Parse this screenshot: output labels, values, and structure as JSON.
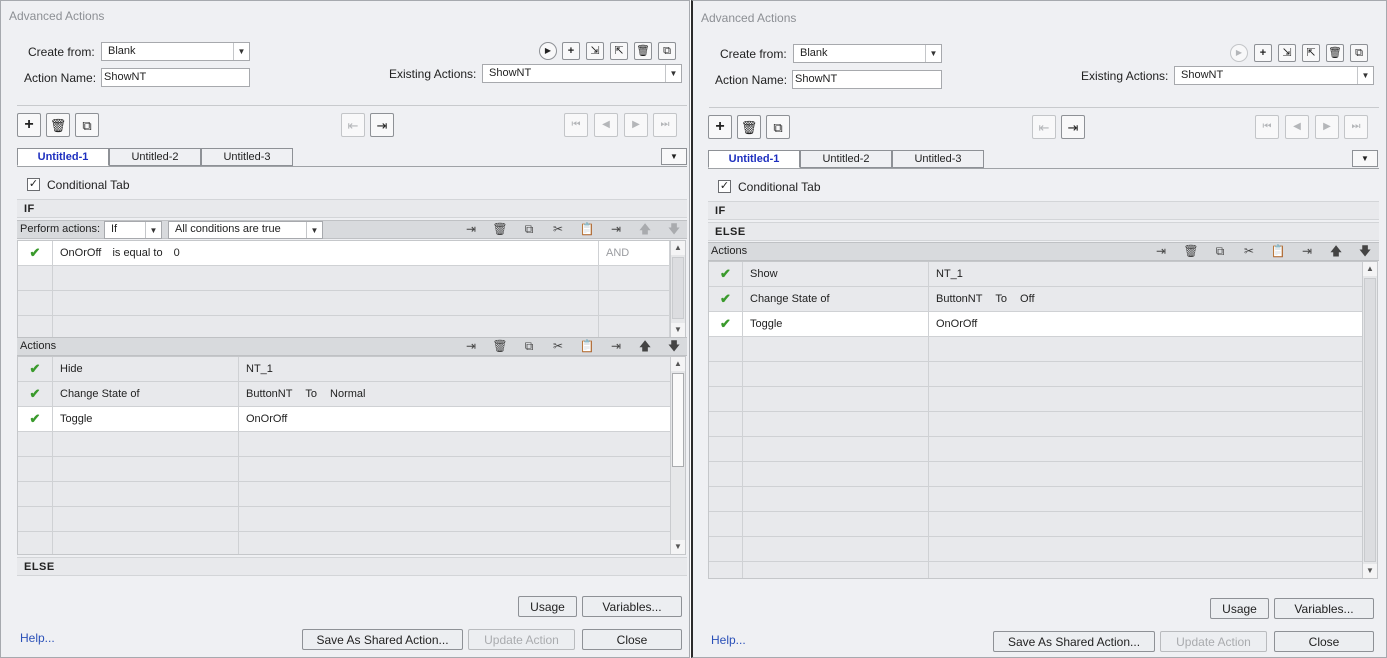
{
  "left": {
    "title": "Advanced Actions",
    "create_from_label": "Create from:",
    "create_from_value": "Blank",
    "action_name_label": "Action Name:",
    "action_name_value": "ShowNT",
    "existing_label": "Existing Actions:",
    "existing_value": "ShowNT",
    "tabs": [
      "Untitled-1",
      "Untitled-2",
      "Untitled-3"
    ],
    "conditional_label": "Conditional Tab",
    "if_label": "IF",
    "perform_label": "Perform actions:",
    "perform_value": "If",
    "conditions_value": "All conditions are true",
    "condition_rows": [
      {
        "var": "OnOrOff",
        "op": "is equal to",
        "val": "0",
        "logic": "AND"
      }
    ],
    "actions_label": "Actions",
    "action_rows": [
      {
        "action": "Hide",
        "t1": "NT_1",
        "t2": "",
        "t3": ""
      },
      {
        "action": "Change State of",
        "t1": "ButtonNT",
        "t2": "To",
        "t3": "Normal"
      },
      {
        "action": "Toggle",
        "t1": "OnOrOff",
        "t2": "",
        "t3": ""
      }
    ],
    "else_label": "ELSE",
    "usage": "Usage",
    "variables": "Variables...",
    "help": "Help...",
    "save_shared": "Save As Shared Action...",
    "update": "Update Action",
    "close": "Close"
  },
  "right": {
    "title": "Advanced Actions",
    "create_from_label": "Create from:",
    "create_from_value": "Blank",
    "action_name_label": "Action Name:",
    "action_name_value": "ShowNT",
    "existing_label": "Existing Actions:",
    "existing_value": "ShowNT",
    "tabs": [
      "Untitled-1",
      "Untitled-2",
      "Untitled-3"
    ],
    "conditional_label": "Conditional Tab",
    "if_label": "IF",
    "else_label": "ELSE",
    "actions_label": "Actions",
    "action_rows": [
      {
        "action": "Show",
        "t1": "NT_1",
        "t2": "",
        "t3": ""
      },
      {
        "action": "Change State of",
        "t1": "ButtonNT",
        "t2": "To",
        "t3": "Off"
      },
      {
        "action": "Toggle",
        "t1": "OnOrOff",
        "t2": "",
        "t3": ""
      }
    ],
    "usage": "Usage",
    "variables": "Variables...",
    "help": "Help...",
    "save_shared": "Save As Shared Action...",
    "update": "Update Action",
    "close": "Close"
  },
  "icons": {
    "check": "✔",
    "plus": "+",
    "trash": "🗑",
    "copy": "⎘",
    "cut": "✂",
    "paste": "📋",
    "up": "🡅",
    "down": "🡇",
    "insert": "⇥",
    "play": "▶",
    "first": "⏮",
    "prev": "◀",
    "next": "▶",
    "last": "⏭",
    "dropdown": "▼"
  }
}
